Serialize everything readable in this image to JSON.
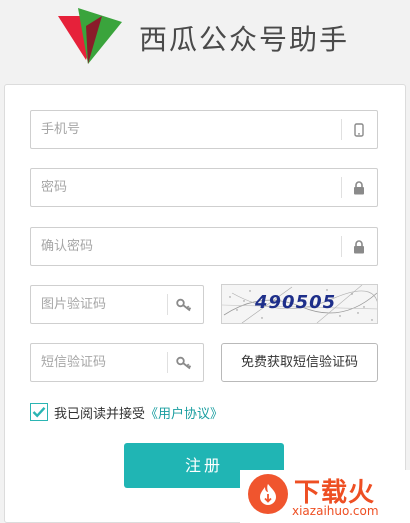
{
  "header": {
    "title": "西瓜公众号助手",
    "logo_icon": "triangle-logo-icon",
    "logo_colors": [
      "#e6213a",
      "#3aa43c",
      "#8a1c2a"
    ]
  },
  "form": {
    "phone": {
      "placeholder": "手机号",
      "icon": "phone-icon"
    },
    "password": {
      "placeholder": "密码",
      "icon": "lock-icon"
    },
    "confirm_password": {
      "placeholder": "确认密码",
      "icon": "lock-icon"
    },
    "image_code": {
      "placeholder": "图片验证码",
      "icon": "key-icon"
    },
    "captcha_text": "490505",
    "sms_code": {
      "placeholder": "短信验证码",
      "icon": "key-icon"
    },
    "sms_button_label": "免费获取短信验证码",
    "agree": {
      "checked": true,
      "text": "我已阅读并接受",
      "link_text": "《用户协议》"
    },
    "submit_label": "注册"
  },
  "watermark": {
    "title": "下载火",
    "url": "xiazaihuo.com"
  },
  "colors": {
    "accent": "#20b5b4",
    "link": "#1a9ea0",
    "watermark": "#ee4f23"
  }
}
